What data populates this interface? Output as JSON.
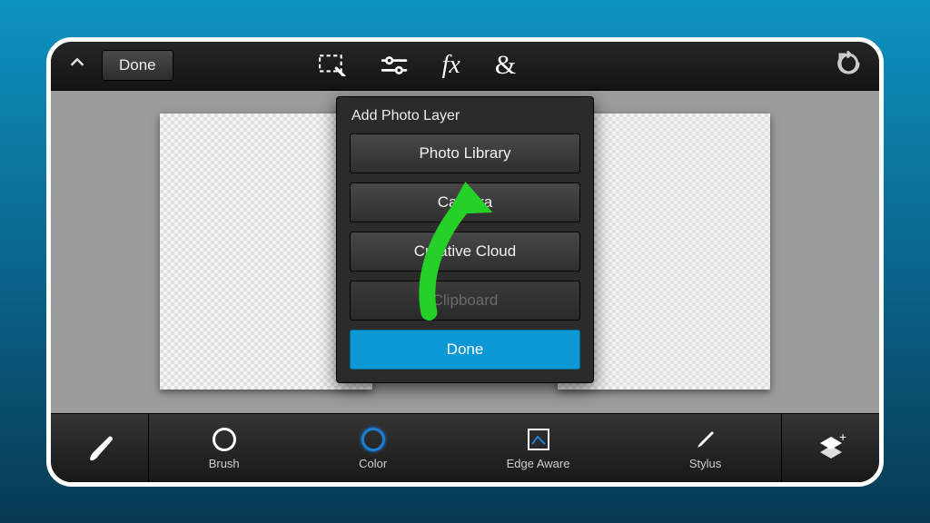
{
  "topbar": {
    "done_label": "Done"
  },
  "popover": {
    "title": "Add Photo Layer",
    "options": {
      "photo_library": "Photo Library",
      "camera": "Camera",
      "creative_cloud": "Creative Cloud",
      "clipboard": "Clipboard"
    },
    "done_label": "Done"
  },
  "dock": {
    "brush": "Brush",
    "color": "Color",
    "edge_aware": "Edge Aware",
    "stylus": "Stylus"
  },
  "colors": {
    "accent": "#0c97d5",
    "arrow": "#25d028"
  }
}
